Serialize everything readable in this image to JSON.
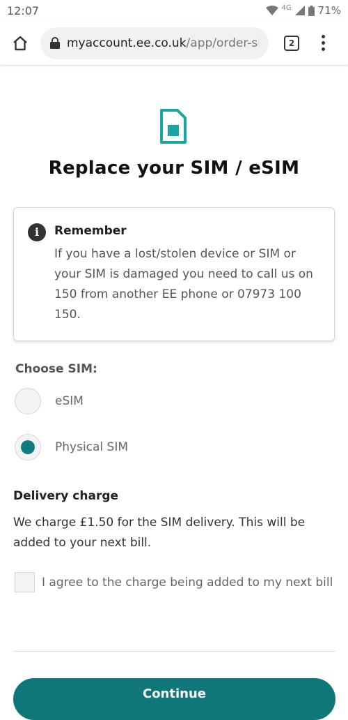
{
  "status_bar": {
    "time": "12:07",
    "network": "4G",
    "battery": "71%",
    "icons": [
      "wifi-icon",
      "signal-icon",
      "battery-icon"
    ]
  },
  "browser": {
    "url_host": "myaccount.ee.co.uk",
    "url_path": "/app/order-si",
    "tab_count": "2"
  },
  "page": {
    "title": "Replace your SIM / eSIM",
    "remember": {
      "title": "Remember",
      "body": "If you have a lost/stolen device or SIM or your SIM is damaged you need to call us on 150 from another EE phone or 07973 100 150."
    },
    "choose_sim": {
      "label": "Choose SIM:",
      "options": [
        {
          "label": "eSIM",
          "selected": false
        },
        {
          "label": "Physical SIM",
          "selected": true
        }
      ]
    },
    "delivery": {
      "title": "Delivery charge",
      "body": "We charge £1.50 for the SIM delivery. This will be added to your next bill."
    },
    "agree_label": "I agree to the charge being added to my next bill",
    "agree_checked": false,
    "continue_label": "Continue"
  },
  "colors": {
    "accent": "#0f777a",
    "icon_teal": "#1aa6a0"
  }
}
